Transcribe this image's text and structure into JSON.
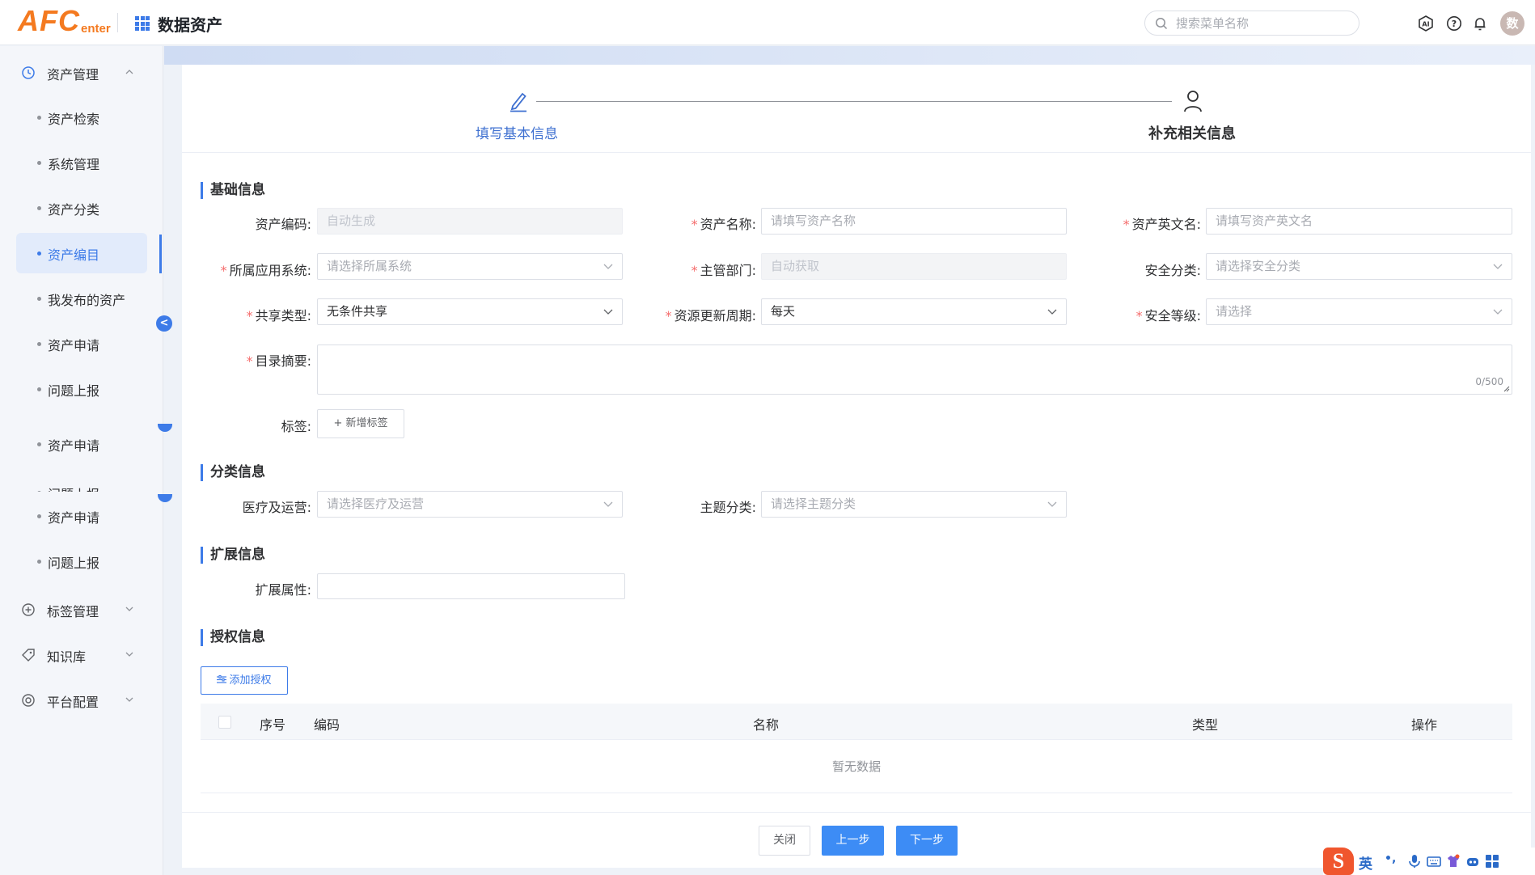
{
  "header": {
    "logo_main": "AFC",
    "logo_sub": "enter",
    "app_title": "数据资产",
    "search_placeholder": "搜索菜单名称",
    "avatar_text": "数"
  },
  "sidebar": {
    "groups": [
      {
        "label": "资产管理",
        "icon": "clock-icon",
        "expanded": true
      },
      {
        "label": "标签管理",
        "icon": "plus-circle-icon",
        "expanded": false
      },
      {
        "label": "知识库",
        "icon": "tag-icon",
        "expanded": false
      },
      {
        "label": "平台配置",
        "icon": "target-icon",
        "expanded": false
      }
    ],
    "items": [
      "资产检索",
      "系统管理",
      "资产分类",
      "资产编目",
      "我发布的资产",
      "资产申请",
      "问题上报",
      "资产申请",
      "问题上报",
      "资产申请",
      "问题上报"
    ],
    "active_item": "资产编目",
    "collapse_label": "<"
  },
  "steps": [
    {
      "label": "填写基本信息",
      "icon": "pencil-icon",
      "active": true
    },
    {
      "label": "补充相关信息",
      "icon": "user-icon",
      "active": false
    }
  ],
  "sections": {
    "basic": "基础信息",
    "category": "分类信息",
    "extension": "扩展信息",
    "authorization": "授权信息"
  },
  "fields": {
    "asset_code": {
      "label": "资产编码:",
      "placeholder": "自动生成",
      "required": false
    },
    "asset_name": {
      "label": "资产名称:",
      "placeholder": "请填写资产名称",
      "required": true
    },
    "asset_en_name": {
      "label": "资产英文名:",
      "placeholder": "请填写资产英文名",
      "required": true
    },
    "app_system": {
      "label": "所属应用系统:",
      "placeholder": "请选择所属系统",
      "required": true
    },
    "department": {
      "label": "主管部门:",
      "placeholder": "自动获取",
      "required": true
    },
    "security_class": {
      "label": "安全分类:",
      "placeholder": "请选择安全分类",
      "required": false
    },
    "share_type": {
      "label": "共享类型:",
      "value": "无条件共享",
      "required": true
    },
    "update_cycle": {
      "label": "资源更新周期:",
      "value": "每天",
      "required": true
    },
    "security_level": {
      "label": "安全等级:",
      "placeholder": "请选择",
      "required": true
    },
    "summary": {
      "label": "目录摘要:",
      "counter": "0/500",
      "required": true
    },
    "tags": {
      "label": "标签:",
      "button": "+ 新增标签"
    },
    "medical_ops": {
      "label": "医疗及运营:",
      "placeholder": "请选择医疗及运营"
    },
    "topic_class": {
      "label": "主题分类:",
      "placeholder": "请选择主题分类"
    },
    "ext_attr": {
      "label": "扩展属性:",
      "value": ""
    }
  },
  "auth": {
    "add_button": "添加授权",
    "columns": [
      "序号",
      "编码",
      "名称",
      "类型",
      "操作"
    ],
    "empty_text": "暂无数据"
  },
  "footer": {
    "close": "关闭",
    "prev": "上一步",
    "next": "下一步"
  },
  "ime": {
    "lang": "英",
    "punct": "•,"
  },
  "colors": {
    "accent": "#3d7be8",
    "brand": "#f47a20",
    "required": "#f56c6c",
    "primary_button": "#3d8cf5"
  }
}
